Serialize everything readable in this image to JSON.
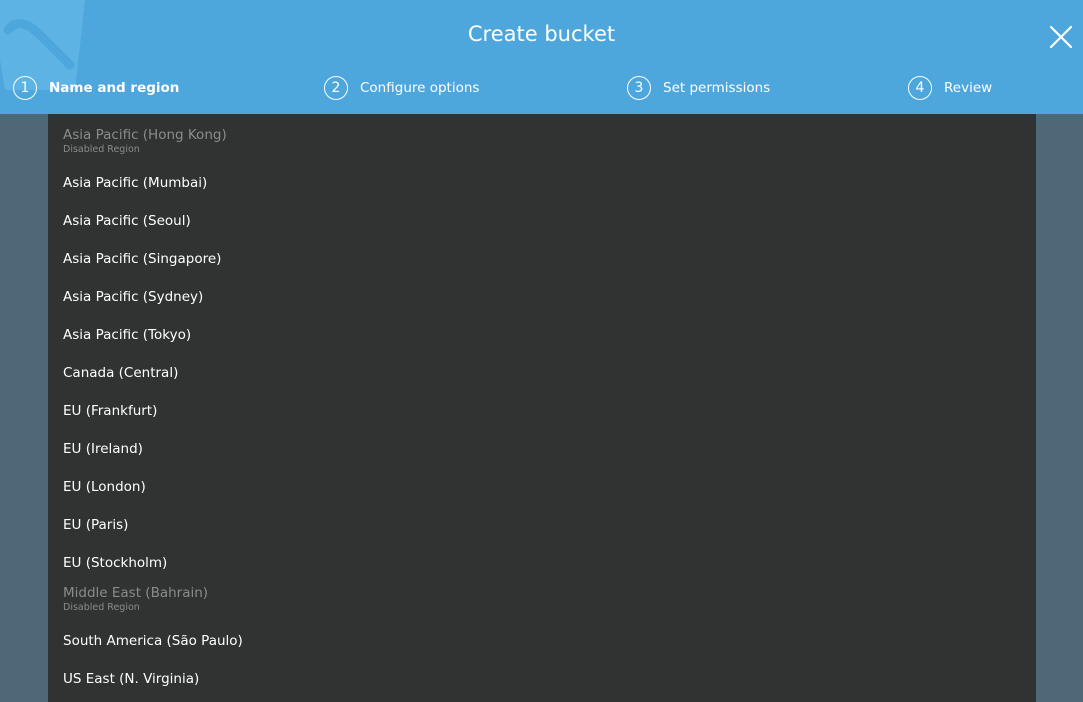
{
  "dialog": {
    "title": "Create bucket",
    "close_icon": "close-icon"
  },
  "steps": [
    {
      "number": "1",
      "label": "Name and region",
      "active": true
    },
    {
      "number": "2",
      "label": "Configure options",
      "active": false
    },
    {
      "number": "3",
      "label": "Set permissions",
      "active": false
    },
    {
      "number": "4",
      "label": "Review",
      "active": false
    }
  ],
  "regions": [
    {
      "name": "Asia Pacific (Hong Kong)",
      "note": "Disabled Region",
      "disabled": true
    },
    {
      "name": "Asia Pacific (Mumbai)",
      "disabled": false
    },
    {
      "name": "Asia Pacific (Seoul)",
      "disabled": false
    },
    {
      "name": "Asia Pacific (Singapore)",
      "disabled": false
    },
    {
      "name": "Asia Pacific (Sydney)",
      "disabled": false
    },
    {
      "name": "Asia Pacific (Tokyo)",
      "disabled": false
    },
    {
      "name": "Canada (Central)",
      "disabled": false
    },
    {
      "name": "EU (Frankfurt)",
      "disabled": false
    },
    {
      "name": "EU (Ireland)",
      "disabled": false
    },
    {
      "name": "EU (London)",
      "disabled": false
    },
    {
      "name": "EU (Paris)",
      "disabled": false
    },
    {
      "name": "EU (Stockholm)",
      "disabled": false
    },
    {
      "name": "Middle East (Bahrain)",
      "note": "Disabled Region",
      "disabled": true
    },
    {
      "name": "South America (São Paulo)",
      "disabled": false
    },
    {
      "name": "US East (N. Virginia)",
      "disabled": false
    }
  ],
  "colors": {
    "header_bg": "#4ea7dc",
    "dropdown_bg": "#313232",
    "backdrop": "#4e6877",
    "disabled_text": "#8a8c8c"
  }
}
